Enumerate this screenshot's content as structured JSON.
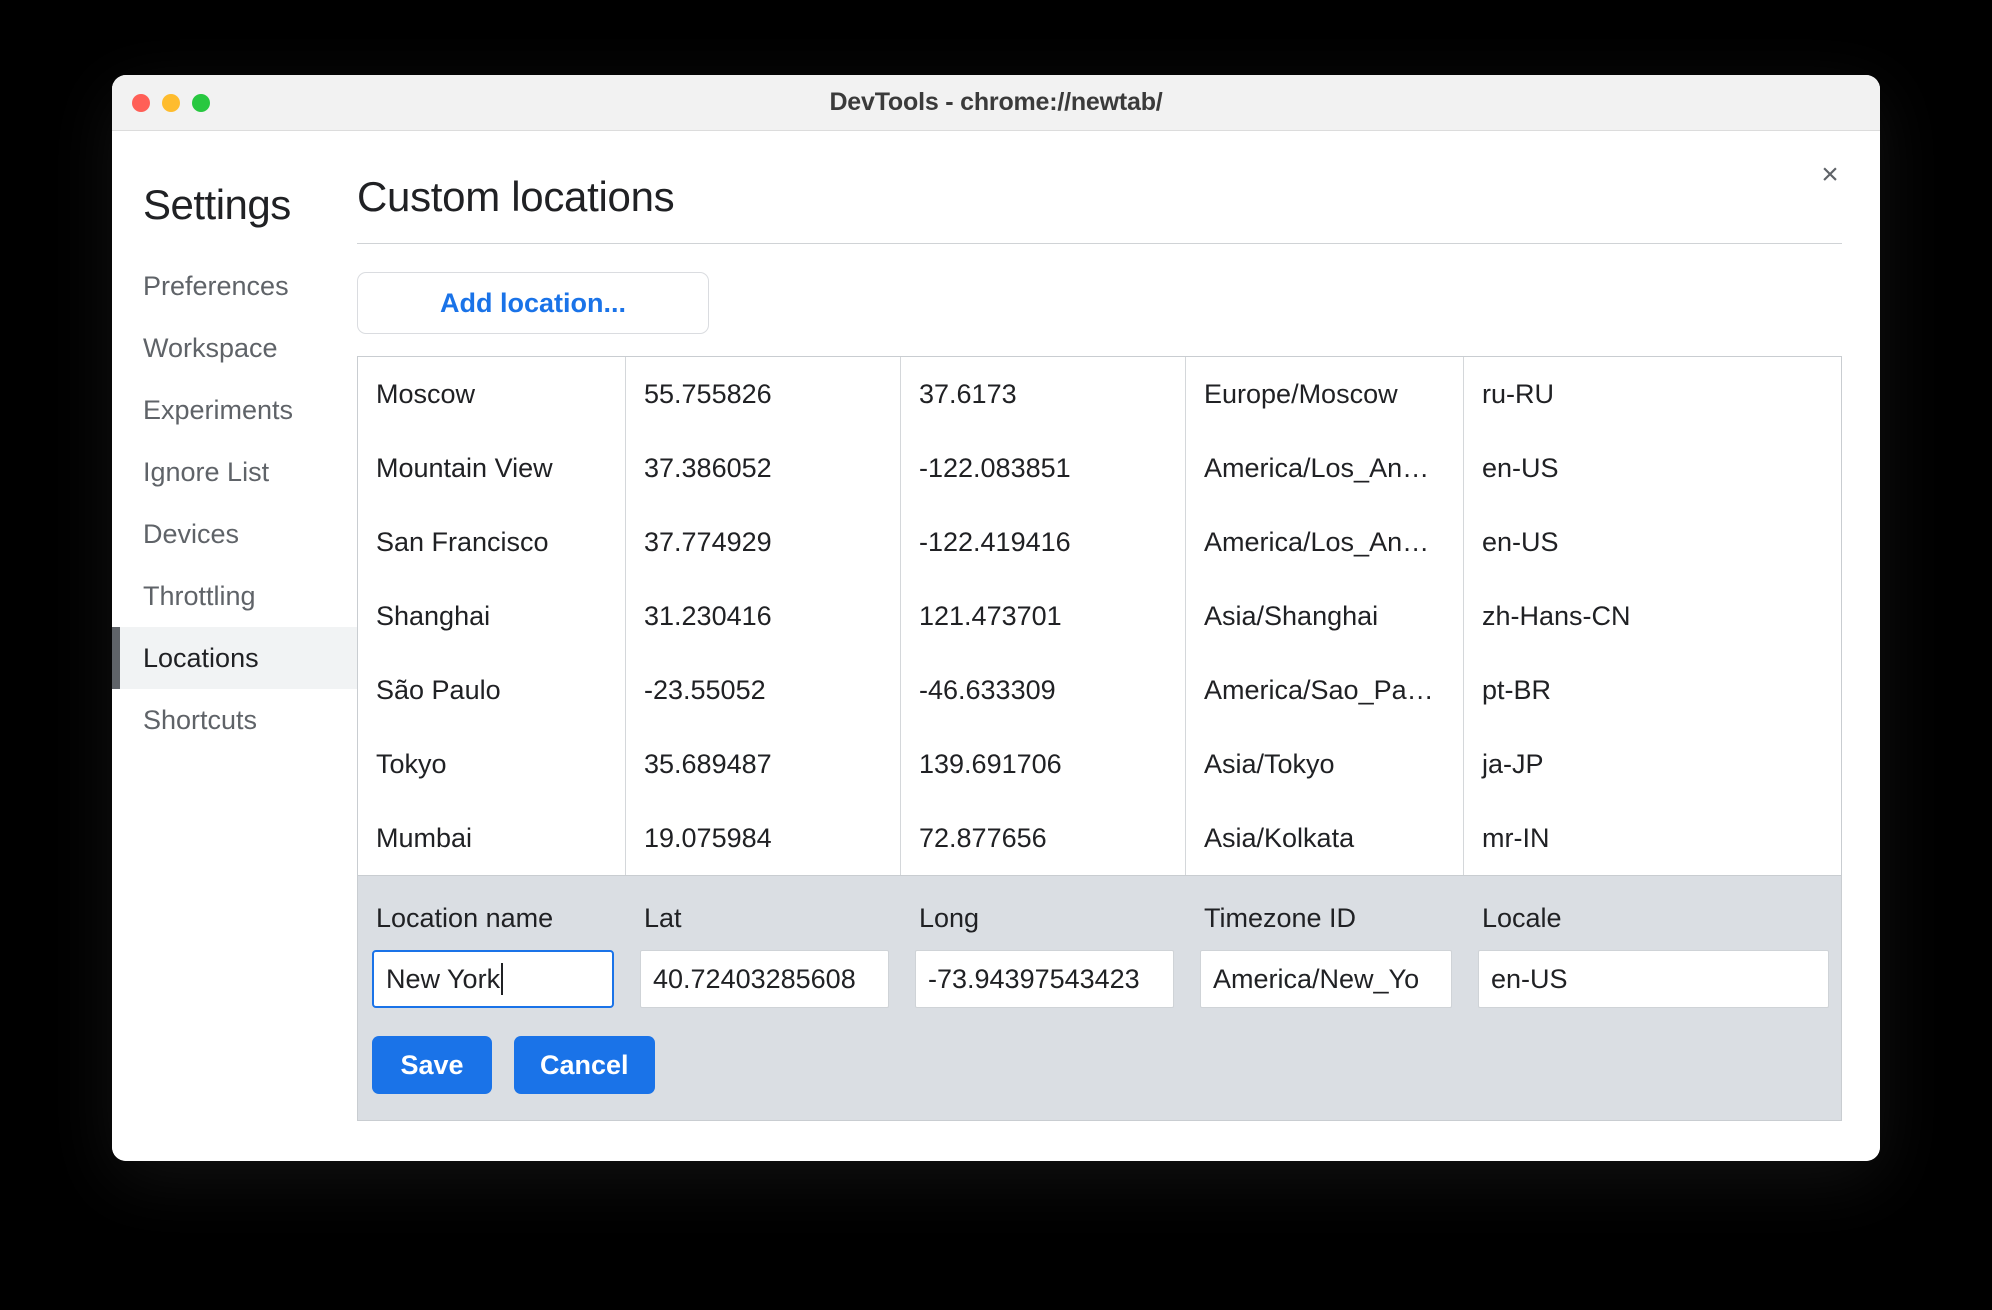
{
  "window": {
    "title": "DevTools - chrome://newtab/",
    "traffic_lights": [
      "close-red",
      "minimize-yellow",
      "maximize-green"
    ]
  },
  "close_button": {
    "glyph": "×",
    "name": "close-icon"
  },
  "sidebar": {
    "title": "Settings",
    "items": [
      {
        "label": "Preferences",
        "selected": false
      },
      {
        "label": "Workspace",
        "selected": false
      },
      {
        "label": "Experiments",
        "selected": false
      },
      {
        "label": "Ignore List",
        "selected": false
      },
      {
        "label": "Devices",
        "selected": false
      },
      {
        "label": "Throttling",
        "selected": false
      },
      {
        "label": "Locations",
        "selected": true
      },
      {
        "label": "Shortcuts",
        "selected": false
      }
    ]
  },
  "main": {
    "title": "Custom locations",
    "add_button": "Add location..."
  },
  "table": {
    "columns": [
      "Location name",
      "Lat",
      "Long",
      "Timezone ID",
      "Locale"
    ],
    "rows": [
      {
        "name": "Moscow",
        "lat": "55.755826",
        "long": "37.6173",
        "tz": "Europe/Moscow",
        "locale": "ru-RU"
      },
      {
        "name": "Mountain View",
        "lat": "37.386052",
        "long": "-122.083851",
        "tz": "America/Los_An…",
        "locale": "en-US"
      },
      {
        "name": "San Francisco",
        "lat": "37.774929",
        "long": "-122.419416",
        "tz": "America/Los_An…",
        "locale": "en-US"
      },
      {
        "name": "Shanghai",
        "lat": "31.230416",
        "long": "121.473701",
        "tz": "Asia/Shanghai",
        "locale": "zh-Hans-CN"
      },
      {
        "name": "São Paulo",
        "lat": "-23.55052",
        "long": "-46.633309",
        "tz": "America/Sao_Pa…",
        "locale": "pt-BR"
      },
      {
        "name": "Tokyo",
        "lat": "35.689487",
        "long": "139.691706",
        "tz": "Asia/Tokyo",
        "locale": "ja-JP"
      },
      {
        "name": "Mumbai",
        "lat": "19.075984",
        "long": "72.877656",
        "tz": "Asia/Kolkata",
        "locale": "mr-IN"
      }
    ]
  },
  "editor": {
    "headers": {
      "name": "Location name",
      "lat": "Lat",
      "long": "Long",
      "tz": "Timezone ID",
      "locale": "Locale"
    },
    "values": {
      "name": "New York",
      "lat": "40.72403285608",
      "long": "-73.94397543423",
      "tz": "America/New_Yo",
      "locale": "en-US"
    },
    "focused_field": "name",
    "save_label": "Save",
    "cancel_label": "Cancel"
  },
  "colors": {
    "accent_blue": "#1a73e8",
    "editor_background": "#dadee3",
    "selected_item_background": "#f1f3f4",
    "selected_item_bar": "#5f6368",
    "text_primary": "#202124",
    "text_secondary": "#5f6368"
  }
}
